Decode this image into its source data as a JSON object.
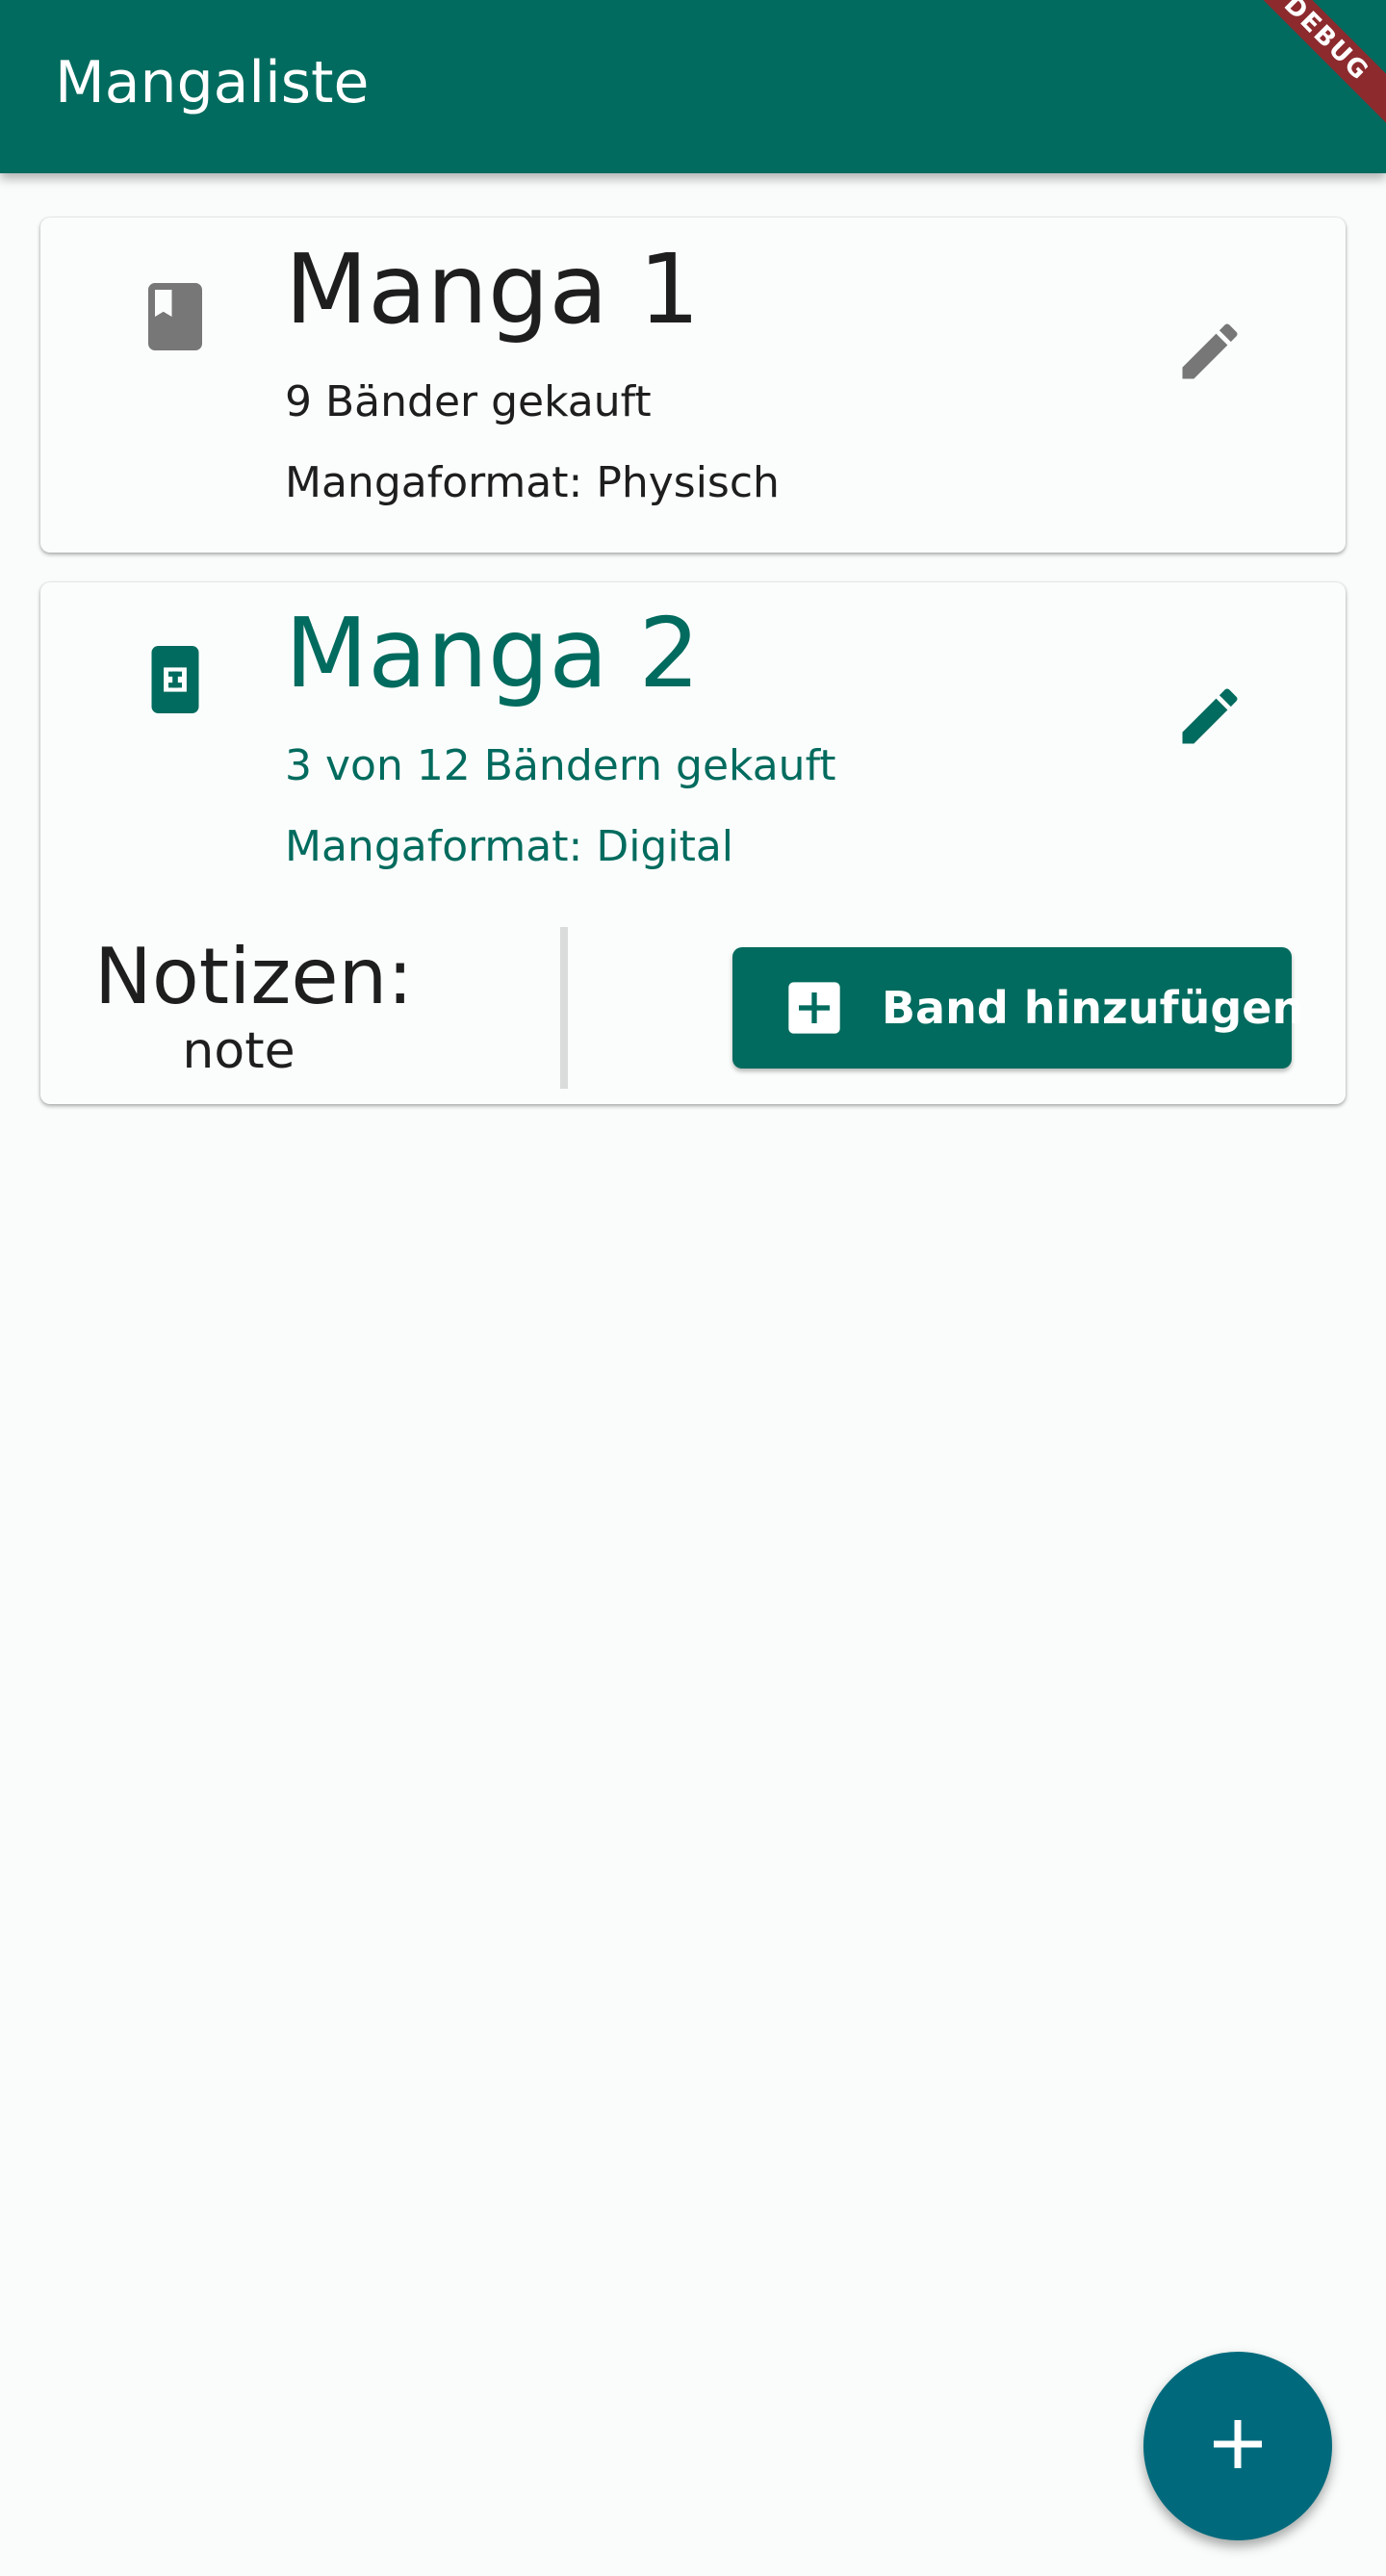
{
  "app_bar": {
    "title": "Mangaliste",
    "debug_banner": "DEBUG"
  },
  "manga_list": [
    {
      "title": "Manga 1",
      "volumes": "9 Bänder gekauft",
      "format": "Mangaformat: Physisch",
      "leading_icon": "book-icon",
      "edit_icon": "pencil-icon",
      "color": "#1e1e1e",
      "icon_color": "#777777"
    },
    {
      "title": "Manga 2",
      "volumes": "3 von 12 Bändern gekauft",
      "format": "Mangaformat: Digital",
      "leading_icon": "tablet-icon",
      "edit_icon": "pencil-icon",
      "color": "#006b5e",
      "notes_label": "Notizen:",
      "notes_value": "note",
      "add_volume_label": "Band hinzufügen"
    }
  ],
  "fab": {
    "icon": "plus-icon"
  },
  "colors": {
    "primary": "#006b5e",
    "fab": "#006a7c",
    "background": "#f9fcfb",
    "debug_banner": "#8c2a2e"
  }
}
